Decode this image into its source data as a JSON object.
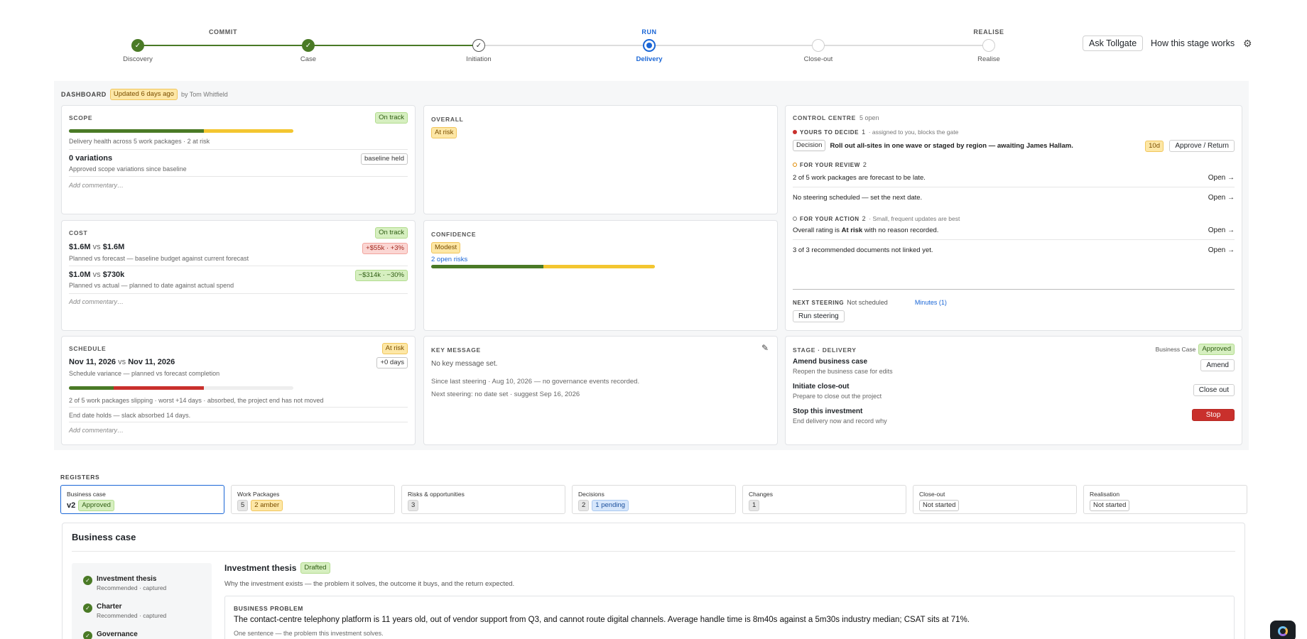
{
  "stepper": {
    "groups": [
      {
        "label": "COMMIT",
        "active": false
      },
      {
        "label": "RUN",
        "active": true
      },
      {
        "label": "REALISE",
        "active": false
      }
    ],
    "steps": [
      {
        "label": "Discovery",
        "state": "done"
      },
      {
        "label": "Case",
        "state": "done"
      },
      {
        "label": "Initiation",
        "state": "checked"
      },
      {
        "label": "Delivery",
        "state": "current"
      },
      {
        "label": "Close-out",
        "state": "future"
      },
      {
        "label": "Realise",
        "state": "future"
      }
    ]
  },
  "header": {
    "ask_label": "Ask Tollgate",
    "how_label": "How this stage works",
    "settings_icon": "gear-icon"
  },
  "dashboard": {
    "title": "DASHBOARD",
    "updated": "Updated 6 days ago",
    "by": "by Tom Whitfield"
  },
  "scope": {
    "title": "SCOPE",
    "status": "On track",
    "health_green_pct": 60,
    "health_amber_pct": 40,
    "health_text": "Delivery health across 5 work packages · 2 at risk",
    "variations": "0 variations",
    "variations_badge": "baseline held",
    "variations_sub": "Approved scope variations since baseline",
    "commentary": "Add commentary…"
  },
  "cost": {
    "title": "COST",
    "status": "On track",
    "forecast_a": "$1.6M",
    "forecast_vs": "vs",
    "forecast_b": "$1.6M",
    "forecast_delta": "+$55k · +3%",
    "forecast_sub": "Planned vs forecast — baseline budget against current forecast",
    "actual_a": "$1.0M",
    "actual_vs": "vs",
    "actual_b": "$730k",
    "actual_delta": "−$314k · −30%",
    "actual_sub": "Planned vs actual — planned to date against actual spend",
    "commentary": "Add commentary…"
  },
  "schedule": {
    "title": "SCHEDULE",
    "status": "At risk",
    "date_a": "Nov 11, 2026",
    "date_vs": "vs",
    "date_b": "Nov 11, 2026",
    "delta": "+0 days",
    "sub": "Schedule variance — planned vs forecast completion",
    "bar_green_pct": 20,
    "bar_red_pct": 40,
    "slip_text": "2 of 5 work packages slipping · worst +14 days · absorbed, the project end has not moved",
    "end_text": "End date holds — slack absorbed 14 days.",
    "commentary": "Add commentary…"
  },
  "overall": {
    "title": "OVERALL",
    "status": "At risk"
  },
  "confidence": {
    "title": "CONFIDENCE",
    "status": "Modest",
    "risks_link": "2 open risks",
    "bar_green_pct": 50,
    "bar_amber_pct": 50
  },
  "key_message": {
    "title": "KEY MESSAGE",
    "edit_icon": "edit-icon",
    "empty": "No key message set.",
    "since": "Since last steering · Aug 10, 2026 — no governance events recorded.",
    "next": "Next steering: no date set · suggest Sep 16, 2026"
  },
  "control_centre": {
    "title": "CONTROL CENTRE",
    "count": "5 open",
    "decide": {
      "label": "YOURS TO DECIDE",
      "count": "1",
      "note": "· assigned to you, blocks the gate",
      "tag": "Decision",
      "text": "Roll out all-sites in one wave or staged by region — awaiting",
      "person": "James Hallam.",
      "due": "10d",
      "action": "Approve / Return"
    },
    "review": {
      "label": "FOR YOUR REVIEW",
      "count": "2",
      "items": [
        {
          "text": "2 of 5 work packages are forecast to be late.",
          "action": "Open →"
        },
        {
          "text": "No steering scheduled — set the next date.",
          "action": "Open →"
        }
      ]
    },
    "action_sec": {
      "label": "FOR YOUR ACTION",
      "count": "2",
      "note": "· Small, frequent updates are best",
      "item1_pre": "Overall rating is",
      "item1_bold": "At risk",
      "item1_post": "with no reason recorded.",
      "item1_action": "Open →",
      "item2_text": "3 of 3 recommended documents not linked yet.",
      "item2_action": "Open →"
    },
    "steering": {
      "label": "NEXT STEERING",
      "value": "Not scheduled",
      "minutes": "Minutes (1)",
      "button": "Run steering"
    }
  },
  "stage": {
    "title": "STAGE · DELIVERY",
    "bc_label": "Business Case",
    "bc_status": "Approved",
    "actions": [
      {
        "title": "Amend business case",
        "sub": "Reopen the business case for edits",
        "button": "Amend",
        "danger": false
      },
      {
        "title": "Initiate close-out",
        "sub": "Prepare to close out the project",
        "button": "Close out",
        "danger": false
      },
      {
        "title": "Stop this investment",
        "sub": "End delivery now and record why",
        "button": "Stop",
        "danger": true
      }
    ]
  },
  "registers": {
    "title": "REGISTERS",
    "items": [
      {
        "name": "Business case",
        "value": "v2",
        "badge": "Approved",
        "badge2": ""
      },
      {
        "name": "Work Packages",
        "value": "",
        "badge": "5",
        "badge2": "2 amber"
      },
      {
        "name": "Risks & opportunities",
        "value": "",
        "badge": "3",
        "badge2": ""
      },
      {
        "name": "Decisions",
        "value": "",
        "badge": "2",
        "badge2": "1 pending"
      },
      {
        "name": "Changes",
        "value": "",
        "badge": "1",
        "badge2": ""
      },
      {
        "name": "Close-out",
        "value": "",
        "badge": "Not started",
        "badge2": ""
      },
      {
        "name": "Realisation",
        "value": "",
        "badge": "Not started",
        "badge2": ""
      }
    ]
  },
  "business_case": {
    "title": "Business case",
    "nav": [
      {
        "name": "Investment thesis",
        "sub": "Recommended · captured"
      },
      {
        "name": "Charter",
        "sub": "Recommended · captured"
      },
      {
        "name": "Governance",
        "sub": ""
      }
    ],
    "thesis_title": "Investment thesis",
    "thesis_status": "Drafted",
    "thesis_sub": "Why the investment exists — the problem it solves, the outcome it buys, and the return expected.",
    "problem_label": "BUSINESS PROBLEM",
    "problem_text": "The contact-centre telephony platform is 11 years old, out of vendor support from Q3, and cannot route digital channels. Average handle time is 8m40s against a 5m30s industry median; CSAT sits at 71%.",
    "problem_hint": "One sentence — the problem this investment solves."
  }
}
